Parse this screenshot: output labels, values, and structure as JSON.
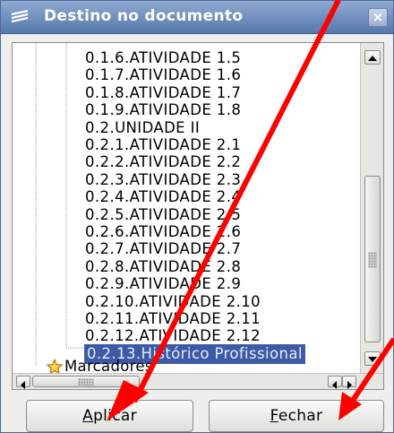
{
  "window": {
    "title": "Destino no documento",
    "close_symbol": "×"
  },
  "tree": {
    "items": [
      {
        "label": "0.1.6.ATIVIDADE 1.5"
      },
      {
        "label": "0.1.7.ATIVIDADE 1.6"
      },
      {
        "label": "0.1.8.ATIVIDADE 1.7"
      },
      {
        "label": "0.1.9.ATIVIDADE 1.8"
      },
      {
        "label": "0.2.UNIDADE II"
      },
      {
        "label": "0.2.1.ATIVIDADE 2.1"
      },
      {
        "label": "0.2.2.ATIVIDADE 2.2"
      },
      {
        "label": "0.2.3.ATIVIDADE 2.3"
      },
      {
        "label": "0.2.4.ATIVIDADE 2.4"
      },
      {
        "label": "0.2.5.ATIVIDADE 2.5"
      },
      {
        "label": "0.2.6.ATIVIDADE 2.6"
      },
      {
        "label": "0.2.7.ATIVIDADE 2.7"
      },
      {
        "label": "0.2.8.ATIVIDADE 2.8"
      },
      {
        "label": "0.2.9.ATIVIDADE 2.9"
      },
      {
        "label": "0.2.10.ATIVIDADE 2.10"
      },
      {
        "label": "0.2.11.ATIVIDADE 2.11"
      },
      {
        "label": "0.2.12.ATIVIDADE 2.12"
      },
      {
        "label": "0.2.13.Histórico Profissional",
        "selected": true
      }
    ],
    "bookmarks_label": "Marcadores",
    "bookmarks_icon": "star-icon"
  },
  "buttons": {
    "apply": {
      "access_key": "A",
      "rest": "plicar"
    },
    "close": {
      "access_key": "F",
      "rest": "echar"
    }
  },
  "colors": {
    "titlebar": "#5678ad",
    "selection": "#3c5aa6",
    "annotation_arrow": "#ff0000"
  }
}
